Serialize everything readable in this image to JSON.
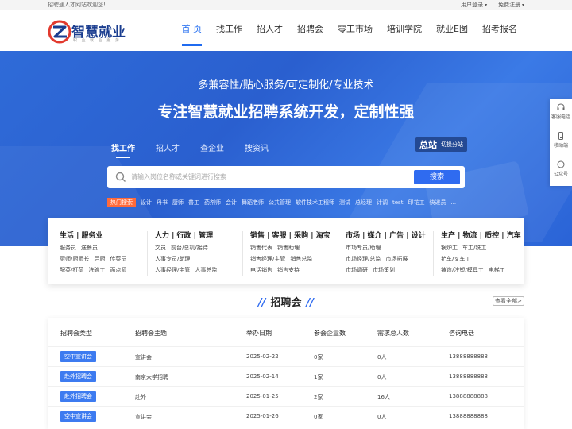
{
  "topbar": {
    "welcome": "招聘通人才网站欢迎您!",
    "user_login": "用户登录",
    "free_register": "免费注册"
  },
  "logo": {
    "name": "智慧就业",
    "sub": "职 业 就 业 服 务"
  },
  "nav": [
    "首 页",
    "找工作",
    "招人才",
    "招聘会",
    "零工市场",
    "培训学院",
    "就业E图",
    "招考报名"
  ],
  "hero": {
    "subtitle": "多兼容性/贴心服务/可定制化/专业技术",
    "title": "专注智慧就业招聘系统开发，定制性强",
    "tabs": [
      "找工作",
      "招人才",
      "查企业",
      "搜资讯"
    ],
    "station_main": "总站",
    "station_switch": "切换分站",
    "search_placeholder": "请输入岗位名称或关键词进行搜索",
    "search_button": "搜索",
    "hot_label": "热门搜索",
    "hot_keywords": [
      "设计",
      "丹书",
      "厨师",
      "普工",
      "药剂师",
      "会计",
      "舞蹈老师",
      "公共管理",
      "软件技术工程师",
      "测试",
      "总经理",
      "计调",
      "test",
      "印花工",
      "快递员",
      "..."
    ]
  },
  "categories": [
    {
      "title": "生活 | 服务业",
      "lines": [
        [
          "服务员",
          "送餐员"
        ],
        [
          "厨师/厨师长",
          "后厨",
          "传菜员"
        ],
        [
          "配菜/打荷",
          "洗碗工",
          "面点师"
        ]
      ]
    },
    {
      "title": "人力 | 行政 | 管理",
      "lines": [
        [
          "文员",
          "前台/总机/接待"
        ],
        [
          "人事专员/助理"
        ],
        [
          "人事经理/主管",
          "人事总监"
        ]
      ]
    },
    {
      "title": "销售 | 客服 | 采购 | 淘宝",
      "lines": [
        [
          "销售代表",
          "销售助理"
        ],
        [
          "销售经理/主管",
          "销售总监"
        ],
        [
          "电话销售",
          "销售支持"
        ]
      ]
    },
    {
      "title": "市场 | 媒介 | 广告 | 设计",
      "lines": [
        [
          "市场专员/助理"
        ],
        [
          "市场经理/总监",
          "市场拓展"
        ],
        [
          "市场调研",
          "市场策划"
        ]
      ]
    },
    {
      "title": "生产 | 物流 | 质控 | 汽车",
      "lines": [
        [
          "锅炉工",
          "车工/铣工"
        ],
        [
          "铲车/叉车工"
        ],
        [
          "铸造/注塑/模具工",
          "电梯工"
        ]
      ]
    }
  ],
  "side": [
    "客服电话",
    "移动端",
    "公众号"
  ],
  "fair": {
    "title": "招聘会",
    "view_all": "查看全部>",
    "headers": [
      "招聘会类型",
      "招聘会主题",
      "举办日期",
      "参会企业数",
      "需求总人数",
      "咨询电话"
    ],
    "rows": [
      {
        "type": "空中宣讲会",
        "theme": "宣讲会",
        "date": "2025-02-22",
        "companies": "0家",
        "people": "0人",
        "phone": "13888888888"
      },
      {
        "type": "赴外招聘会",
        "theme": "南京大学招聘",
        "date": "2025-02-14",
        "companies": "1家",
        "people": "0人",
        "phone": "13888888888"
      },
      {
        "type": "赴外招聘会",
        "theme": "赴外",
        "date": "2025-01-25",
        "companies": "2家",
        "people": "16人",
        "phone": "13888888888"
      },
      {
        "type": "空中宣讲会",
        "theme": "宣讲会",
        "date": "2025-01-26",
        "companies": "0家",
        "people": "0人",
        "phone": "13888888888"
      }
    ]
  },
  "colors": {
    "brand_blue": "#2f6bf0",
    "hot_orange": "#ff6a3a",
    "badge_blue": "#3d7bf0"
  }
}
